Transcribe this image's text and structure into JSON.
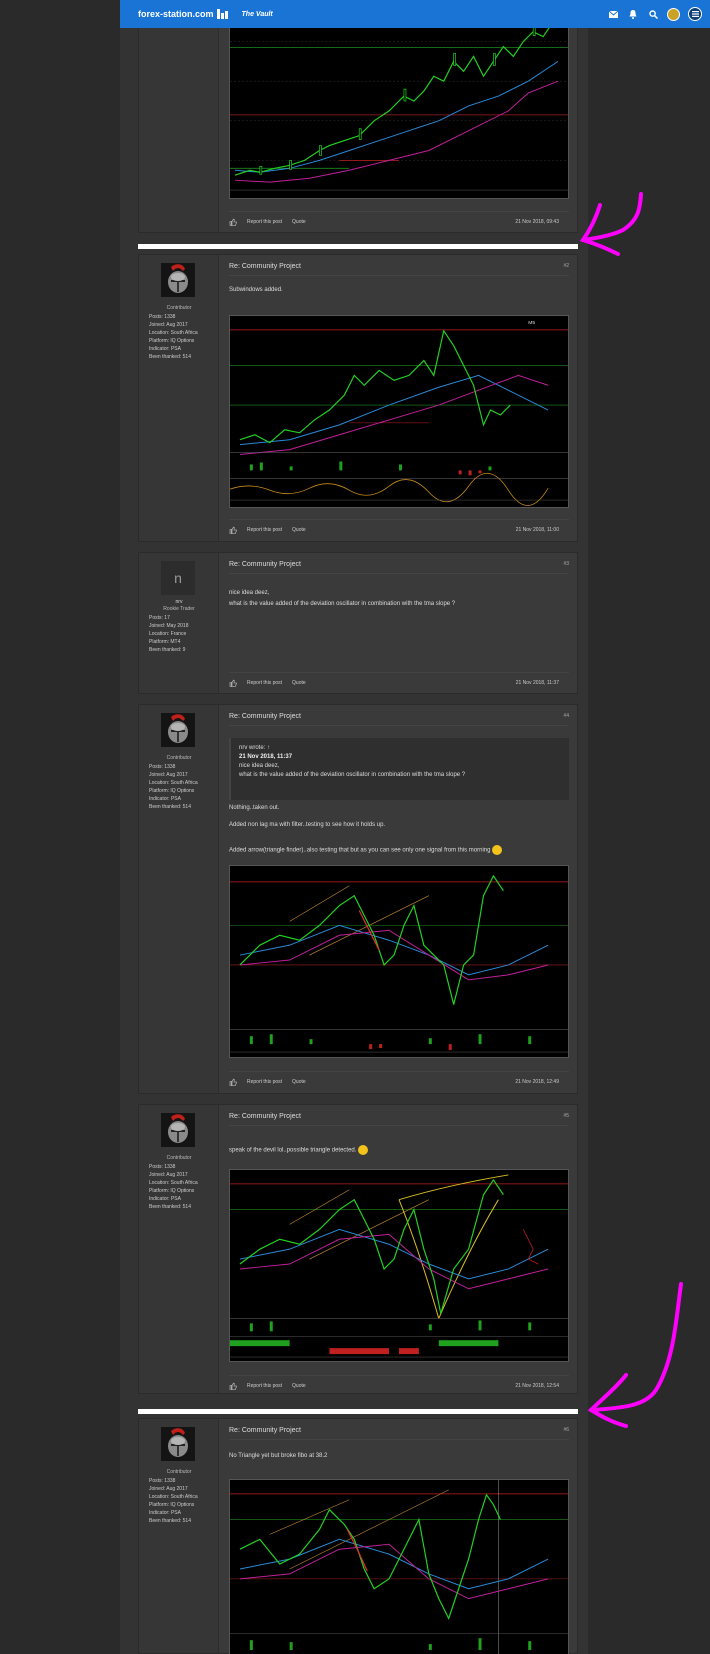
{
  "nav": {
    "logo": "forex-station.com",
    "vault": "The Vault"
  },
  "colors": {
    "nav": "#1a74d6",
    "arrow": "#ff00ff",
    "chart_bg": "#000000"
  },
  "posts": [
    {
      "footer": {
        "report": "Report this post",
        "quote": "Quote",
        "date": "21 Nov 2018, 09:43"
      }
    },
    {
      "title": "Re: Community Project",
      "num": "#2",
      "rank": "Contributor",
      "stats": [
        "Posts: 1338",
        "Joined: Aug 2017",
        "Location: South Africa",
        "Platform: IQ Options",
        "Indicator: PSA",
        "Been thanked: 514"
      ],
      "text": "Subwindows added.",
      "footer": {
        "report": "Report this post",
        "quote": "Quote",
        "date": "21 Nov 2018, 11:00"
      }
    },
    {
      "title": "Re: Community Project",
      "num": "#3",
      "avatar_letter": "n",
      "name": "nrv",
      "rank": "Rookie Trader",
      "stats": [
        "Posts: 17",
        "Joined: May 2018",
        "Location: France",
        "Platform: MT4",
        "Been thanked: 9"
      ],
      "text1": "nice idea deez,",
      "text2": "what is the value added of the deviation oscillator in combination with the tma slope ?",
      "footer": {
        "report": "Report this post",
        "quote": "Quote",
        "date": "21 Nov 2018, 11:37"
      }
    },
    {
      "title": "Re: Community Project",
      "num": "#4",
      "rank": "Contributor",
      "stats": [
        "Posts: 1338",
        "Joined: Aug 2017",
        "Location: South Africa",
        "Platform: IQ Options",
        "Indicator: PSA",
        "Been thanked: 514"
      ],
      "quote_author": "nrv wrote: ↑",
      "quote_date": "21 Nov 2018, 11:37",
      "quote1": "nice idea deez,",
      "quote2": "what is the value added of the deviation oscillator in combination with the tma slope ?",
      "text1": "Nothing..taken out.",
      "text2": "Added non lag ma with filter..testing to see how it holds up.",
      "text3": "Added arrow(triangle finder)..also testing that but as you can see only one signal from this morning",
      "footer": {
        "report": "Report this post",
        "quote": "Quote",
        "date": "21 Nov 2018, 12:49"
      }
    },
    {
      "title": "Re: Community Project",
      "num": "#5",
      "rank": "Contributor",
      "stats": [
        "Posts: 1338",
        "Joined: Aug 2017",
        "Location: South Africa",
        "Platform: IQ Options",
        "Indicator: PSA",
        "Been thanked: 514"
      ],
      "text": "speak of the devil lol..possible triangle detected.",
      "footer": {
        "report": "Report this post",
        "quote": "Quote",
        "date": "21 Nov 2018, 12:54"
      }
    },
    {
      "title": "Re: Community Project",
      "num": "#6",
      "rank": "Contributor",
      "stats": [
        "Posts: 1338",
        "Joined: Aug 2017",
        "Location: South Africa",
        "Platform: IQ Options",
        "Indicator: PSA",
        "Been thanked: 514"
      ],
      "text": "No Triangle yet but broke fibo at 38.2"
    }
  ]
}
